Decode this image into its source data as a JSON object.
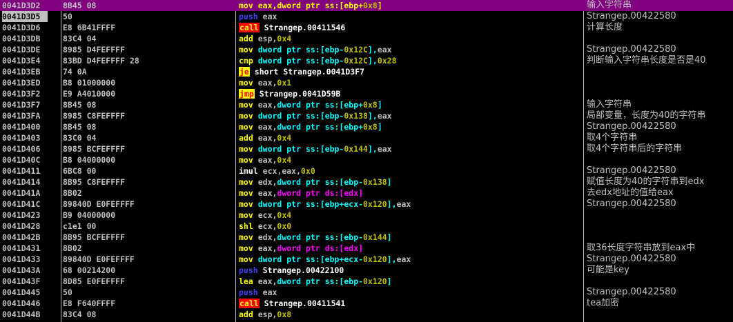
{
  "colors": {
    "background": "#000000",
    "selection": "#800080",
    "mnemonic_mov": "#ffff00",
    "mnemonic_push": "#4040ff",
    "mnemonic_call_bg": "#ff0000",
    "mnemonic_jmp_bg": "#ffff00",
    "memory_operand": "#00ffff",
    "immediate": "#c0c000",
    "ds_pointer": "#ff00ff"
  },
  "rows": [
    {
      "addr": "0041D3D2",
      "hex": "8B45 08",
      "mn": "mov",
      "mc": "mov",
      "ops": [
        [
          "eax,",
          "reg"
        ],
        [
          "dword ptr ss:[ebp+",
          "mem"
        ],
        [
          "0x8",
          "num"
        ],
        [
          "]",
          "mem"
        ]
      ],
      "cmt": "输入字符串",
      "sel": true
    },
    {
      "addr": "0041D3D5",
      "hex": "50",
      "mn": "push",
      "mc": "push",
      "ops": [
        [
          "eax",
          "reg"
        ]
      ],
      "cmt": "Strangep.00422580",
      "cur": true
    },
    {
      "addr": "0041D3D6",
      "hex": "E8 6B41FFFF",
      "mn": "call",
      "mc": "call",
      "ops": [
        [
          "Strangep.00411546",
          "lbl"
        ]
      ],
      "cmt": "计算长度"
    },
    {
      "addr": "0041D3DB",
      "hex": "83C4 04",
      "mn": "add",
      "mc": "mov",
      "ops": [
        [
          "esp,",
          "reg"
        ],
        [
          "0x4",
          "num"
        ]
      ],
      "cmt": ""
    },
    {
      "addr": "0041D3DE",
      "hex": "8985 D4FEFFFF",
      "mn": "mov",
      "mc": "mov",
      "ops": [
        [
          "dword ptr ss:[ebp-",
          "mem"
        ],
        [
          "0x12C",
          "num"
        ],
        [
          "],",
          "mem"
        ],
        [
          "eax",
          "reg"
        ]
      ],
      "cmt": "Strangep.00422580"
    },
    {
      "addr": "0041D3E4",
      "hex": "83BD D4FEFFFF 28",
      "mn": "cmp",
      "mc": "mov",
      "ops": [
        [
          "dword ptr ss:[ebp-",
          "mem"
        ],
        [
          "0x12C",
          "num"
        ],
        [
          "],",
          "mem"
        ],
        [
          "0x28",
          "num"
        ]
      ],
      "cmt": "判断输入字符串长度是否是40"
    },
    {
      "addr": "0041D3EB",
      "hex": "74 0A",
      "mn": "je",
      "mc": "jcc",
      "ops": [
        [
          "short Strangep.0041D3F7",
          "lbl"
        ]
      ],
      "cmt": ""
    },
    {
      "addr": "0041D3ED",
      "hex": "B8 01000000",
      "mn": "mov",
      "mc": "mov",
      "ops": [
        [
          "eax,",
          "reg"
        ],
        [
          "0x1",
          "num"
        ]
      ],
      "cmt": ""
    },
    {
      "addr": "0041D3F2",
      "hex": "E9 A4010000",
      "mn": "jmp",
      "mc": "jcc",
      "ops": [
        [
          "Strangep.0041D59B",
          "lbl"
        ]
      ],
      "cmt": ""
    },
    {
      "addr": "0041D3F7",
      "hex": "8B45 08",
      "mn": "mov",
      "mc": "mov",
      "ops": [
        [
          "eax,",
          "reg"
        ],
        [
          "dword ptr ss:[ebp+",
          "mem"
        ],
        [
          "0x8",
          "num"
        ],
        [
          "]",
          "mem"
        ]
      ],
      "cmt": "输入字符串"
    },
    {
      "addr": "0041D3FA",
      "hex": "8985 C8FEFFFF",
      "mn": "mov",
      "mc": "mov",
      "ops": [
        [
          "dword ptr ss:[ebp-",
          "mem"
        ],
        [
          "0x138",
          "num"
        ],
        [
          "],",
          "mem"
        ],
        [
          "eax",
          "reg"
        ]
      ],
      "cmt": "局部变量，长度为40的字符串"
    },
    {
      "addr": "0041D400",
      "hex": "8B45 08",
      "mn": "mov",
      "mc": "mov",
      "ops": [
        [
          "eax,",
          "reg"
        ],
        [
          "dword ptr ss:[ebp+",
          "mem"
        ],
        [
          "0x8",
          "num"
        ],
        [
          "]",
          "mem"
        ]
      ],
      "cmt": "Strangep.00422580"
    },
    {
      "addr": "0041D403",
      "hex": "83C0 04",
      "mn": "add",
      "mc": "mov",
      "ops": [
        [
          "eax,",
          "reg"
        ],
        [
          "0x4",
          "num"
        ]
      ],
      "cmt": "取4个字符串"
    },
    {
      "addr": "0041D406",
      "hex": "8985 BCFEFFFF",
      "mn": "mov",
      "mc": "mov",
      "ops": [
        [
          "dword ptr ss:[ebp-",
          "mem"
        ],
        [
          "0x144",
          "num"
        ],
        [
          "],",
          "mem"
        ],
        [
          "eax",
          "reg"
        ]
      ],
      "cmt": "取4个字符串后的字符串"
    },
    {
      "addr": "0041D40C",
      "hex": "B8 04000000",
      "mn": "mov",
      "mc": "mov",
      "ops": [
        [
          "eax,",
          "reg"
        ],
        [
          "0x4",
          "num"
        ]
      ],
      "cmt": ""
    },
    {
      "addr": "0041D411",
      "hex": "6BC8 00",
      "mn": "imul",
      "mc": "imul",
      "ops": [
        [
          "ecx,eax,",
          "reg"
        ],
        [
          "0x0",
          "num"
        ]
      ],
      "cmt": "Strangep.00422580"
    },
    {
      "addr": "0041D414",
      "hex": "8B95 C8FEFFFF",
      "mn": "mov",
      "mc": "mov",
      "ops": [
        [
          "edx,",
          "reg"
        ],
        [
          "dword ptr ss:[ebp-",
          "mem"
        ],
        [
          "0x138",
          "num"
        ],
        [
          "]",
          "mem"
        ]
      ],
      "cmt": "赋值长度为40的字符串到edx"
    },
    {
      "addr": "0041D41A",
      "hex": "8B02",
      "mn": "mov",
      "mc": "mov",
      "ops": [
        [
          "eax,",
          "reg"
        ],
        [
          "dword ptr ds:[edx]",
          "ptr"
        ]
      ],
      "cmt": "去edx地址的值给eax"
    },
    {
      "addr": "0041D41C",
      "hex": "89840D E0FEFFFF",
      "mn": "mov",
      "mc": "mov",
      "ops": [
        [
          "dword ptr ss:[ebp+ecx-",
          "mem"
        ],
        [
          "0x120",
          "num"
        ],
        [
          "],",
          "mem"
        ],
        [
          "eax",
          "reg"
        ]
      ],
      "cmt": "Strangep.00422580"
    },
    {
      "addr": "0041D423",
      "hex": "B9 04000000",
      "mn": "mov",
      "mc": "mov",
      "ops": [
        [
          "ecx,",
          "reg"
        ],
        [
          "0x4",
          "num"
        ]
      ],
      "cmt": ""
    },
    {
      "addr": "0041D428",
      "hex": "c1e1 00",
      "mn": "shl",
      "mc": "mov",
      "ops": [
        [
          "ecx,",
          "reg"
        ],
        [
          "0x0",
          "num"
        ]
      ],
      "cmt": ""
    },
    {
      "addr": "0041D42B",
      "hex": "8B95 BCFEFFFF",
      "mn": "mov",
      "mc": "mov",
      "ops": [
        [
          "edx,",
          "reg"
        ],
        [
          "dword ptr ss:[ebp-",
          "mem"
        ],
        [
          "0x144",
          "num"
        ],
        [
          "]",
          "mem"
        ]
      ],
      "cmt": ""
    },
    {
      "addr": "0041D431",
      "hex": "8B02",
      "mn": "mov",
      "mc": "mov",
      "ops": [
        [
          "eax,",
          "reg"
        ],
        [
          "dword ptr ds:[edx]",
          "ptr"
        ]
      ],
      "cmt": "取36长度字符串放到eax中"
    },
    {
      "addr": "0041D433",
      "hex": "89840D E0FEFFFF",
      "mn": "mov",
      "mc": "mov",
      "ops": [
        [
          "dword ptr ss:[ebp+ecx-",
          "mem"
        ],
        [
          "0x120",
          "num"
        ],
        [
          "],",
          "mem"
        ],
        [
          "eax",
          "reg"
        ]
      ],
      "cmt": "Strangep.00422580"
    },
    {
      "addr": "0041D43A",
      "hex": "68 00214200",
      "mn": "push",
      "mc": "push",
      "ops": [
        [
          "Strangep.00422100",
          "lbl"
        ]
      ],
      "cmt": "可能是key"
    },
    {
      "addr": "0041D43F",
      "hex": "8D85 E0FEFFFF",
      "mn": "lea",
      "mc": "mov",
      "ops": [
        [
          "eax,",
          "reg"
        ],
        [
          "dword ptr ss:[ebp-",
          "mem"
        ],
        [
          "0x120",
          "num"
        ],
        [
          "]",
          "mem"
        ]
      ],
      "cmt": ""
    },
    {
      "addr": "0041D445",
      "hex": "50",
      "mn": "push",
      "mc": "push",
      "ops": [
        [
          "eax",
          "reg"
        ]
      ],
      "cmt": "Strangep.00422580"
    },
    {
      "addr": "0041D446",
      "hex": "E8 F640FFFF",
      "mn": "call",
      "mc": "call",
      "ops": [
        [
          "Strangep.00411541",
          "lbl"
        ]
      ],
      "cmt": "tea加密"
    },
    {
      "addr": "0041D44B",
      "hex": "83C4 08",
      "mn": "add",
      "mc": "mov",
      "ops": [
        [
          "esp,",
          "reg"
        ],
        [
          "0x8",
          "num"
        ]
      ],
      "cmt": ""
    }
  ]
}
